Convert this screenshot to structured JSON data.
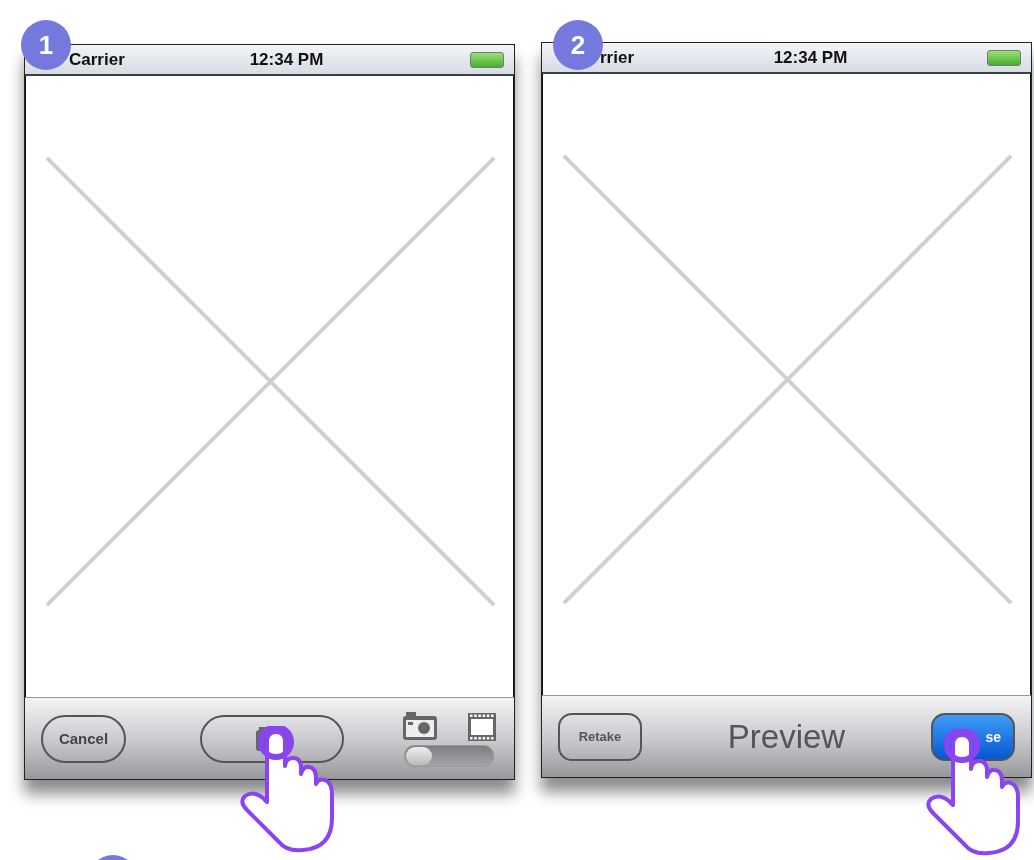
{
  "step_badges": [
    "1",
    "2"
  ],
  "screens": [
    {
      "status_bar": {
        "carrier": "Carrier",
        "time": "12:34 PM"
      },
      "toolbar": {
        "kind": "camera",
        "cancel": "Cancel",
        "mode_switch": {
          "on": false
        }
      }
    },
    {
      "status_bar": {
        "carrier": "rrier",
        "time": "12:34 PM"
      },
      "toolbar": {
        "kind": "preview",
        "retake": "Retake",
        "title": "Preview",
        "use": "se"
      }
    }
  ]
}
